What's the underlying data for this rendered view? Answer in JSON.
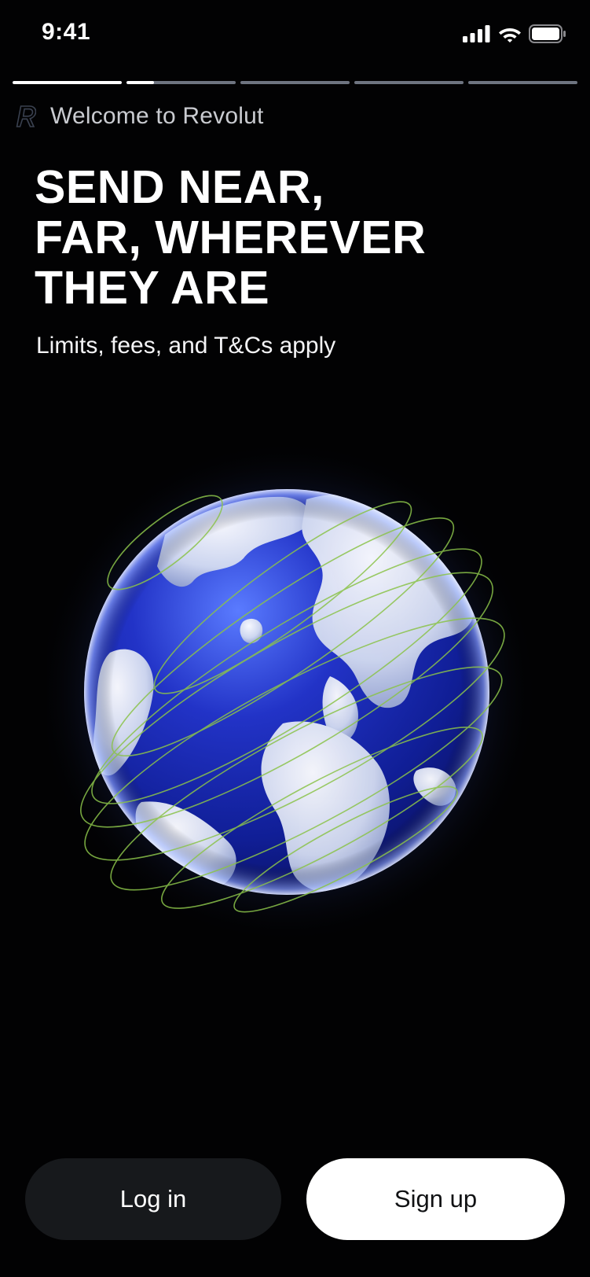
{
  "status_bar": {
    "time": "9:41",
    "icons": [
      "cellular-signal-icon",
      "wifi-icon",
      "battery-icon"
    ]
  },
  "story_progress": {
    "segment_count": 5,
    "current_index": 1,
    "current_fraction": 0.25
  },
  "header": {
    "brand_icon": "revolut-r-logo",
    "welcome_text": "Welcome to Revolut"
  },
  "headline": {
    "line1": "SEND NEAR,",
    "line2": "FAR, WHEREVER",
    "line3": "THEY ARE"
  },
  "disclaimer": "Limits, fees, and T&Cs apply",
  "illustration": {
    "name": "globe-with-orbit-lines",
    "colors": {
      "ocean": "#1a2bb8",
      "land": "#dfe6f4",
      "orbit": "#8bc34a"
    }
  },
  "buttons": {
    "login_label": "Log in",
    "signup_label": "Sign up"
  },
  "colors": {
    "background": "#020203",
    "login_button_bg": "#17191c",
    "signup_button_bg": "#ffffff"
  }
}
